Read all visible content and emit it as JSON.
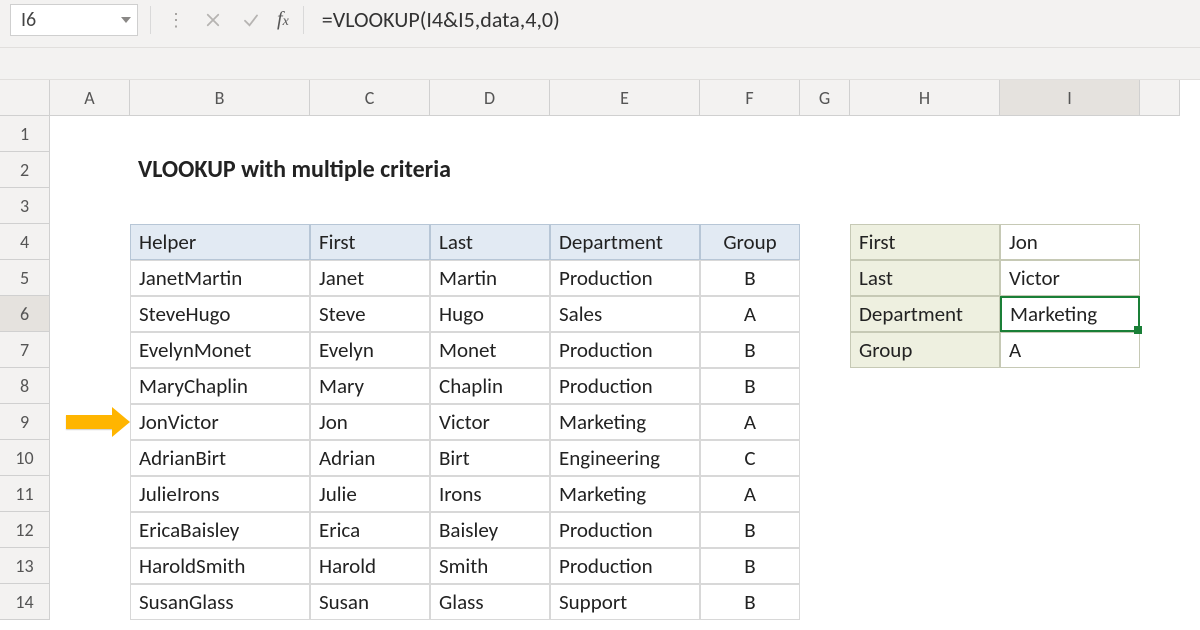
{
  "namebox": {
    "ref": "I6"
  },
  "formula": "=VLOOKUP(I4&I5,data,4,0)",
  "title": "VLOOKUP with multiple criteria",
  "columns": [
    "A",
    "B",
    "C",
    "D",
    "E",
    "F",
    "G",
    "H",
    "I"
  ],
  "rows_visible": [
    "1",
    "2",
    "3",
    "4",
    "5",
    "6",
    "7",
    "8",
    "9",
    "10",
    "11",
    "12",
    "13",
    "14"
  ],
  "active_row": "6",
  "active_col": "I",
  "arrow_row": "9",
  "table": {
    "headers": {
      "helper": "Helper",
      "first": "First",
      "last": "Last",
      "dept": "Department",
      "group": "Group"
    },
    "rows": [
      {
        "helper": "JanetMartin",
        "first": "Janet",
        "last": "Martin",
        "dept": "Production",
        "group": "B"
      },
      {
        "helper": "SteveHugo",
        "first": "Steve",
        "last": "Hugo",
        "dept": "Sales",
        "group": "A"
      },
      {
        "helper": "EvelynMonet",
        "first": "Evelyn",
        "last": "Monet",
        "dept": "Production",
        "group": "B"
      },
      {
        "helper": "MaryChaplin",
        "first": "Mary",
        "last": "Chaplin",
        "dept": "Production",
        "group": "B"
      },
      {
        "helper": "JonVictor",
        "first": "Jon",
        "last": "Victor",
        "dept": "Marketing",
        "group": "A"
      },
      {
        "helper": "AdrianBirt",
        "first": "Adrian",
        "last": "Birt",
        "dept": "Engineering",
        "group": "C"
      },
      {
        "helper": "JulieIrons",
        "first": "Julie",
        "last": "Irons",
        "dept": "Marketing",
        "group": "A"
      },
      {
        "helper": "EricaBaisley",
        "first": "Erica",
        "last": "Baisley",
        "dept": "Production",
        "group": "B"
      },
      {
        "helper": "HaroldSmith",
        "first": "Harold",
        "last": "Smith",
        "dept": "Production",
        "group": "B"
      },
      {
        "helper": "SusanGlass",
        "first": "Susan",
        "last": "Glass",
        "dept": "Support",
        "group": "B"
      }
    ]
  },
  "lookup": {
    "labels": {
      "first": "First",
      "last": "Last",
      "dept": "Department",
      "group": "Group"
    },
    "values": {
      "first": "Jon",
      "last": "Victor",
      "dept": "Marketing",
      "group": "A"
    }
  }
}
